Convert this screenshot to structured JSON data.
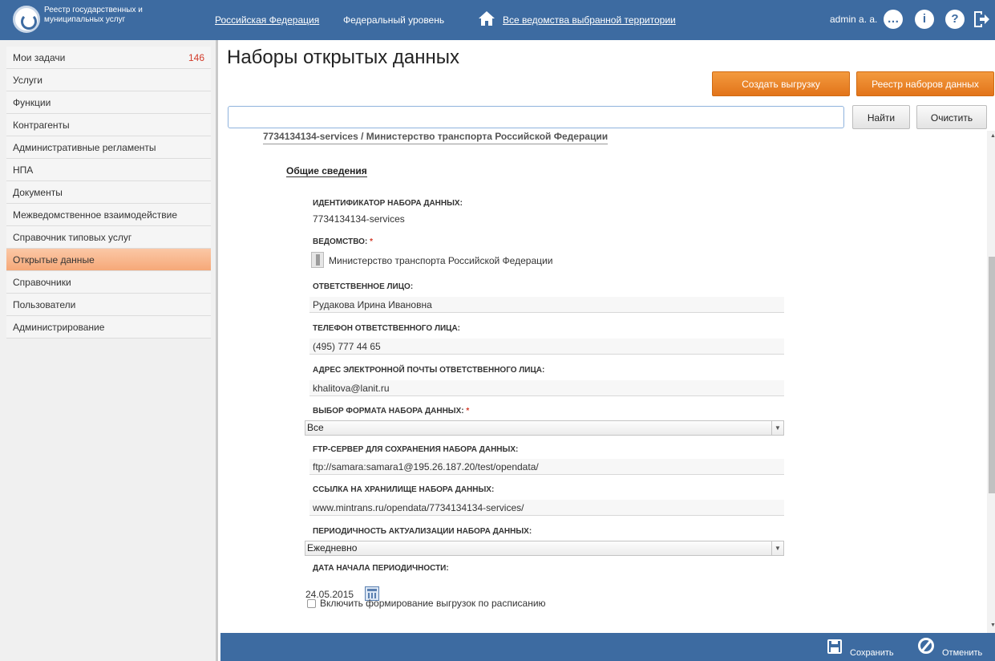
{
  "header": {
    "logo_text": "Реестр государственных и муниципальных услуг",
    "region": "Российская Федерация",
    "level": "Федеральный уровень",
    "departments": "Все ведомства выбранной территории",
    "user": "admin a. a."
  },
  "sidebar": {
    "items": [
      {
        "label": "Мои задачи",
        "count": "146"
      },
      {
        "label": "Услуги"
      },
      {
        "label": "Функции"
      },
      {
        "label": "Контрагенты"
      },
      {
        "label": "Административные регламенты"
      },
      {
        "label": "НПА"
      },
      {
        "label": "Документы"
      },
      {
        "label": "Межведомственное взаимодействие"
      },
      {
        "label": "Справочник типовых услуг"
      },
      {
        "label": "Открытые данные",
        "active": true
      },
      {
        "label": "Справочники"
      },
      {
        "label": "Пользователи"
      },
      {
        "label": "Администрирование"
      }
    ]
  },
  "main": {
    "title": "Наборы открытых данных",
    "create_button": "Создать выгрузку",
    "registry_button": "Реестр наборов данных",
    "search_value": "",
    "find_button": "Найти",
    "clear_button": "Очистить",
    "breadcrumb": "7734134134-services / Министерство транспорта Российской Федерации",
    "section_title": "Общие сведения"
  },
  "form": {
    "id_label": "ИДЕНТИФИКАТОР НАБОРА ДАННЫХ:",
    "id_value": "7734134134-services",
    "dept_label": "ВЕДОМСТВО:",
    "dept_value": "Министерство транспорта Российской Федерации",
    "person_label": "ОТВЕТСТВЕННОЕ ЛИЦО:",
    "person_value": "Рудакова Ирина Ивановна",
    "phone_label": "ТЕЛЕФОН ОТВЕТСТВЕННОГО ЛИЦА:",
    "phone_value": "(495) 777 44 65",
    "email_label": "АДРЕС ЭЛЕКТРОННОЙ ПОЧТЫ ОТВЕТСТВЕННОГО ЛИЦА:",
    "email_value": "khalitova@lanit.ru",
    "format_label": "ВЫБОР ФОРМАТА НАБОРА ДАННЫХ:",
    "format_value": "Все",
    "ftp_label": "FTP-СЕРВЕР ДЛЯ СОХРАНЕНИЯ НАБОРА ДАННЫХ:",
    "ftp_value": "ftp://samara:samara1@195.26.187.20/test/opendata/",
    "link_label": "ССЫЛКА НА ХРАНИЛИЩЕ НАБОРА ДАННЫХ:",
    "link_value": "www.mintrans.ru/opendata/7734134134-services/",
    "period_label": "ПЕРИОДИЧНОСТЬ АКТУАЛИЗАЦИИ НАБОРА ДАННЫХ:",
    "period_value": "Ежедневно",
    "date_label": "ДАТА НАЧАЛА ПЕРИОДИЧНОСТИ:",
    "date_value": "24.05.2015",
    "schedule_label": "Включить формирование выгрузок по расписанию",
    "required_mark": "*"
  },
  "footer": {
    "save_label": "Сохранить",
    "cancel_label": "Отменить"
  },
  "colors": {
    "header_bg": "#3d6ba1",
    "accent_orange": "#e8821f",
    "active_menu": "#f6a878"
  }
}
